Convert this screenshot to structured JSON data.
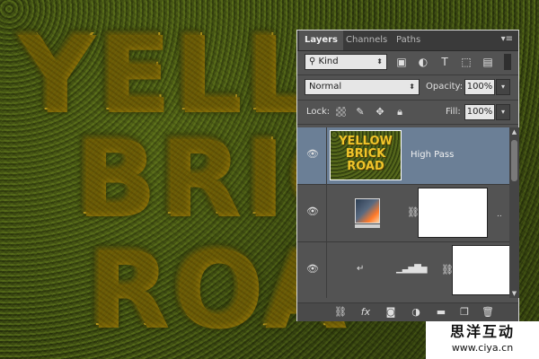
{
  "artwork": {
    "lines": [
      "YELL",
      "BRIC",
      "ROA"
    ]
  },
  "panel": {
    "tabs": [
      {
        "label": "Layers",
        "active": true
      },
      {
        "label": "Channels",
        "active": false
      },
      {
        "label": "Paths",
        "active": false
      }
    ],
    "menu_icon": "panel-menu-icon",
    "filter": {
      "kind_label": "Kind",
      "icons": [
        "image-filter-icon",
        "adjustment-filter-icon",
        "type-filter-icon",
        "shape-filter-icon",
        "smart-object-filter-icon"
      ]
    },
    "blend_mode": "Normal",
    "opacity_label": "Opacity:",
    "opacity_value": "100%",
    "lock_label": "Lock:",
    "lock_icons": [
      "lock-transparent-pixels-icon",
      "lock-image-pixels-icon",
      "lock-position-icon",
      "lock-all-icon"
    ],
    "fill_label": "Fill:",
    "fill_value": "100%",
    "layers": [
      {
        "name": "High Pass",
        "thumb_text": "YELLOW BRICK ROAD",
        "selected": true,
        "type": "smart-object"
      },
      {
        "name": "",
        "selected": false,
        "type": "gradient-map-adjustment"
      },
      {
        "name": "",
        "selected": false,
        "type": "levels-adjustment"
      }
    ],
    "footer_icons": [
      "link-layers-icon",
      "fx-icon",
      "add-mask-icon",
      "new-adjustment-icon",
      "new-group-icon",
      "new-layer-icon",
      "trash-icon"
    ],
    "fx_label": "fx"
  },
  "watermark": {
    "title": "思洋互动",
    "url": "www.ciya.cn"
  },
  "colors": {
    "panel_bg": "#535353",
    "selected_layer": "#6b7f96",
    "text_yellow": "#e6b81c",
    "grass": "#3f4d13"
  }
}
